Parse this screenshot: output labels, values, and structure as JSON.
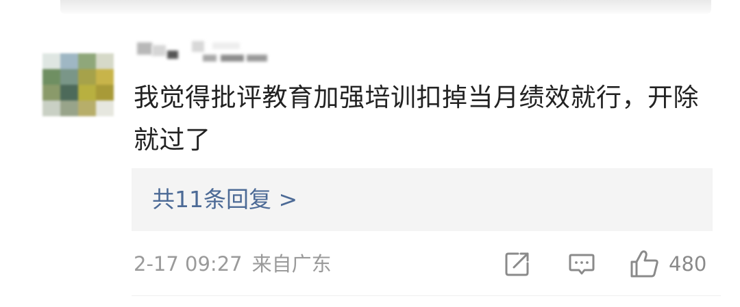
{
  "comment": {
    "text": "我觉得批评教育加强培训扣掉当月绩效就行，开除就过了",
    "replies_label": "共11条回复 >",
    "date": "2-17 09:27",
    "location": "来自广东",
    "like_count": "480"
  },
  "icons": {
    "share": "share-icon",
    "comment": "comment-icon",
    "like": "thumbs-up-icon"
  },
  "colors": {
    "text": "#222222",
    "link": "#4c6a96",
    "meta": "#9a9a9a",
    "reply_bg": "#f4f4f4",
    "icon": "#8a8a8a"
  }
}
